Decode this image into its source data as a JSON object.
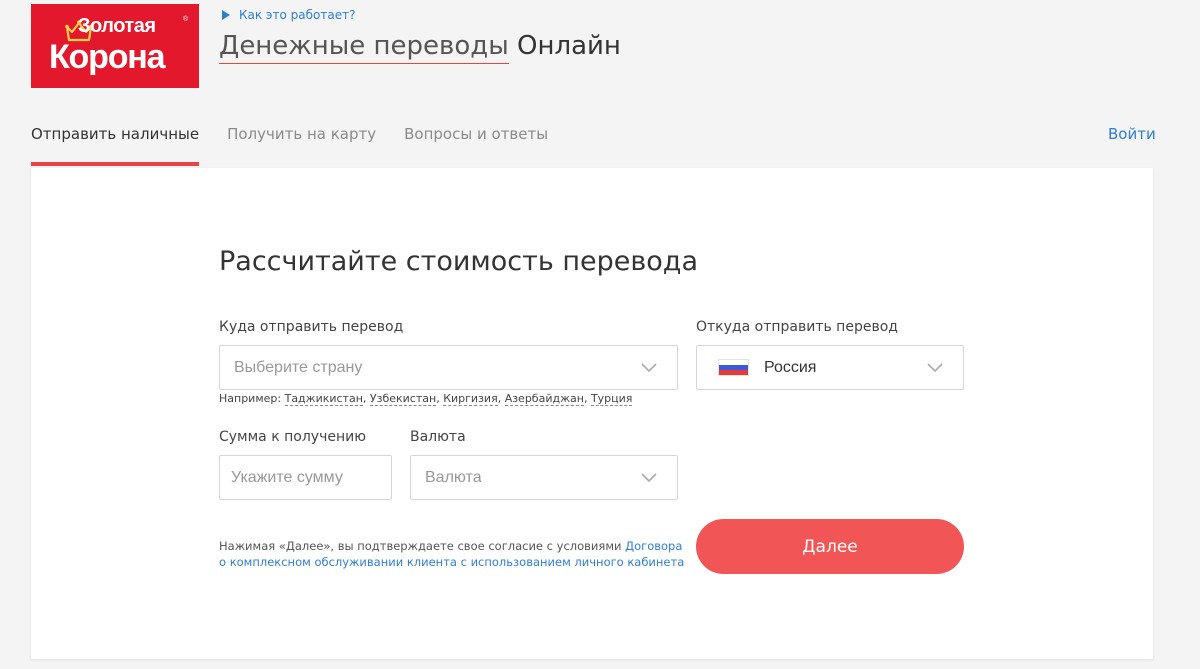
{
  "logo": {
    "line1": "Золотая",
    "line2": "Корона",
    "reg": "®"
  },
  "header": {
    "how_it_works": "Как это работает?",
    "title_part1": "Денежные переводы",
    "title_part2": "Онлайн"
  },
  "tabs": [
    {
      "label": "Отправить наличные",
      "active": true
    },
    {
      "label": "Получить на карту",
      "active": false
    },
    {
      "label": "Вопросы и ответы",
      "active": false
    }
  ],
  "login_label": "Войти",
  "form": {
    "heading": "Рассчитайте стоимость перевода",
    "to_label": "Куда отправить перевод",
    "to_placeholder": "Выберите страну",
    "example_prefix": "Например:",
    "examples": [
      "Таджикистан",
      "Узбекистан",
      "Киргизия",
      "Азербайджан",
      "Турция"
    ],
    "from_label": "Откуда отправить перевод",
    "from_value": "Россия",
    "amount_label": "Сумма к получению",
    "amount_placeholder": "Укажите сумму",
    "currency_label": "Валюта",
    "currency_value": "Валюта",
    "agree_text": "Нажимая «Далее», вы подтверждаете свое согласие с условиями",
    "agree_link": "Договора о комплексном обслуживании клиента с использованием личного кабинета",
    "next_button": "Далее"
  },
  "colors": {
    "brand_red": "#e3182c",
    "accent": "#f25555",
    "link": "#2f7fd1"
  },
  "icons": [
    "crown-icon",
    "play-icon",
    "chevron-down-icon",
    "russia-flag-icon"
  ]
}
